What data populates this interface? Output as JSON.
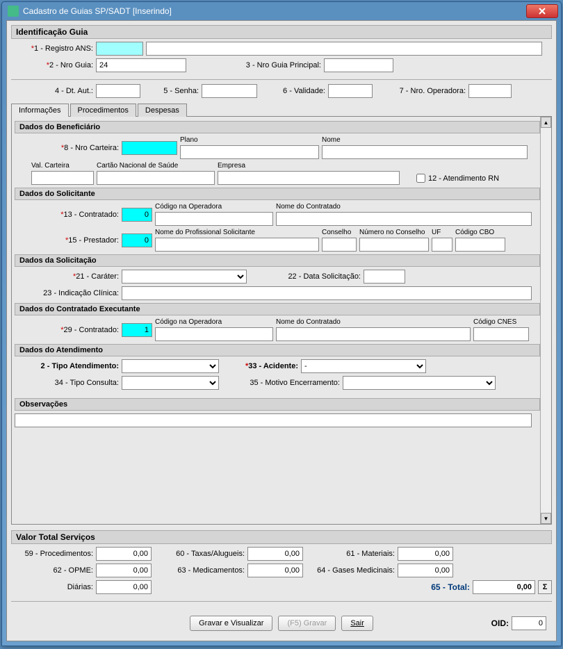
{
  "window_title": "Cadastro de Guias SP/SADT [Inserindo]",
  "identificacao": {
    "title": "Identificação Guia",
    "registro_ans_label": "1 - Registro ANS:",
    "registro_ans_val": "",
    "registro_ans_desc": "",
    "nro_guia_label": "2 - Nro Guia:",
    "nro_guia_val": "24",
    "nro_guia_principal_label": "3 - Nro Guia Principal:",
    "nro_guia_principal_val": "",
    "dt_aut_label": "4 - Dt. Aut.:",
    "dt_aut_val": "",
    "senha_label": "5 - Senha:",
    "senha_val": "",
    "validade_label": "6 - Validade:",
    "validade_val": "",
    "nro_operadora_label": "7 - Nro. Operadora:",
    "nro_operadora_val": ""
  },
  "tabs": {
    "informacoes": "Informações",
    "procedimentos": "Procedimentos",
    "despesas": "Despesas"
  },
  "beneficiario": {
    "title": "Dados do Beneficiário",
    "nro_carteira_label": "8 - Nro Carteira:",
    "nro_carteira_val": "",
    "plano_label": "Plano",
    "plano_val": "",
    "nome_label": "Nome",
    "nome_val": "",
    "val_carteira_label": "Val. Carteira",
    "val_carteira_val": "",
    "cns_label": "Cartão Nacional de Saúde",
    "cns_val": "",
    "empresa_label": "Empresa",
    "empresa_val": "",
    "atendimento_rn_label": "12 - Atendimento RN"
  },
  "solicitante": {
    "title": "Dados do Solicitante",
    "contratado_label": "13 - Contratado:",
    "contratado_val": "0",
    "cod_op_label": "Código na Operadora",
    "cod_op_val": "",
    "nome_contratado_label": "Nome do Contratado",
    "nome_contratado_val": "",
    "prestador_label": "15 - Prestador:",
    "prestador_val": "0",
    "nome_prof_label": "Nome do Profissional Solicitante",
    "nome_prof_val": "",
    "conselho_label": "Conselho",
    "conselho_val": "",
    "num_conselho_label": "Número no Conselho",
    "num_conselho_val": "",
    "uf_label": "UF",
    "uf_val": "",
    "cbo_label": "Código CBO",
    "cbo_val": ""
  },
  "solicitacao": {
    "title": "Dados da Solicitação",
    "carater_label": "21 - Caráter:",
    "carater_val": "",
    "data_sol_label": "22 - Data Solicitação:",
    "data_sol_val": "",
    "indicacao_label": "23 - Indicação Clínica:",
    "indicacao_val": ""
  },
  "executante": {
    "title": "Dados do Contratado Executante",
    "contratado_label": "29 - Contratado:",
    "contratado_val": "1",
    "cod_op_label": "Código na Operadora",
    "cod_op_val": "",
    "nome_label": "Nome do Contratado",
    "nome_val": "",
    "cnes_label": "Código CNES",
    "cnes_val": ""
  },
  "atendimento": {
    "title": "Dados do Atendimento",
    "tipo_atend_label": "2 - Tipo Atendimento:",
    "acidente_label": "33 - Acidente:",
    "acidente_val": "-",
    "tipo_consulta_label": "34 - Tipo Consulta:",
    "motivo_enc_label": "35 - Motivo Encerramento:"
  },
  "observacoes": {
    "title": "Observações",
    "val": ""
  },
  "totais": {
    "title": "Valor Total Serviços",
    "procedimentos_label": "59 - Procedimentos:",
    "procedimentos_val": "0,00",
    "taxas_label": "60 - Taxas/Alugueis:",
    "taxas_val": "0,00",
    "materiais_label": "61 - Materiais:",
    "materiais_val": "0,00",
    "opme_label": "62 - OPME:",
    "opme_val": "0,00",
    "medicamentos_label": "63 - Medicamentos:",
    "medicamentos_val": "0,00",
    "gases_label": "64 - Gases Medicinais:",
    "gases_val": "0,00",
    "diarias_label": "Diárias:",
    "diarias_val": "0,00",
    "total_label": "65 - Total:",
    "total_val": "0,00",
    "sigma": "Σ"
  },
  "buttons": {
    "gravar_vis": "Gravar e Visualizar",
    "gravar": "(F5)  Gravar",
    "sair": "Sair",
    "oid_label": "OID:",
    "oid_val": "0"
  }
}
